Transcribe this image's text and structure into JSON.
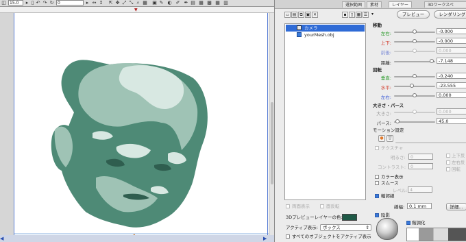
{
  "toolbar": {
    "zoom_value": "15.0",
    "angle_value": "0",
    "items": [
      "rotate-icon",
      "arrow-icon",
      "move-icon",
      "expand-icon",
      "pan-icon",
      "zoom-icon",
      "brush-icon",
      "paint-icon",
      "grid-icon"
    ]
  },
  "panel": {
    "tabs": [
      "選択範囲",
      "素材",
      "レイヤー",
      "3Dワークスペ"
    ],
    "preview_button": "プレビュー",
    "render_button": "レンダリング...",
    "scene_items": [
      {
        "label": "カメラ",
        "selected": true
      },
      {
        "label": "yourMesh.obj",
        "selected": false
      }
    ],
    "move_title": "移動",
    "move_rows": [
      {
        "label": "左右:",
        "value": "-0.000",
        "disabled": false,
        "color": "#2a9a2a"
      },
      {
        "label": "上下:",
        "value": "-0.000",
        "disabled": false,
        "color": "#d23a2a"
      },
      {
        "label": "前後:",
        "value": "0.000",
        "disabled": true,
        "color": "#7a8ad6"
      },
      {
        "label": "距離:",
        "value": "-7.148",
        "disabled": false,
        "color": "#222"
      }
    ],
    "rotate_title": "回転",
    "rotate_rows": [
      {
        "label": "垂直:",
        "value": "-0.240",
        "disabled": false,
        "color": "#2a9a2a"
      },
      {
        "label": "水平:",
        "value": "-23.555",
        "disabled": false,
        "color": "#d23a2a"
      },
      {
        "label": "左右:",
        "value": "0.000",
        "disabled": false,
        "color": "#3a5ad6"
      }
    ],
    "size_title": "大きさ・パース",
    "size_rows": [
      {
        "label": "大きさ:",
        "value": "0.000",
        "disabled": true,
        "color": "#999"
      },
      {
        "label": "パース:",
        "value": "45.0",
        "disabled": false,
        "color": "#222"
      }
    ],
    "motion_title": "モーション設定",
    "texture_label": "テクスチャ",
    "brightness_label": "明るさ:",
    "brightness_value": "0",
    "contrast_label": "コントラスト:",
    "contrast_value": "0",
    "flip_v": "上下反",
    "flip_h": "左右反",
    "rotate_cb": "回転",
    "color_display": "カラー表示",
    "smooth": "スムース",
    "level_label": "レベル:",
    "level_value": "4",
    "outline": "輪郭線",
    "outline_width_label": "線幅:",
    "outline_width_value": "0.1 mm",
    "detail_button": "詳細...",
    "shadow": "陰影",
    "two_sided": "両面表示",
    "flip_faces": "面反転",
    "preview_color_label": "3Dプレビューレイヤーの色:",
    "preview_color": "#1f5a47",
    "active_label": "アクティブ表示:",
    "active_value": "ボックス",
    "all_active": "すべてのオブジェクトをアクティブ表示",
    "posterize": "階調化"
  },
  "colors": {
    "head_dark": "#4e8a76",
    "head_mid": "#9fc3b5",
    "head_light": "#d8e8e2",
    "selection": "#2f6bd6"
  }
}
